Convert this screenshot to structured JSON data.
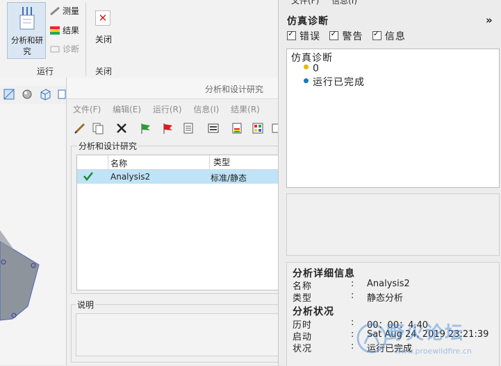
{
  "ribbon": {
    "analyze_label": "分析和研究",
    "measure_label": "测量",
    "results_label": "结果",
    "diagnose_label": "诊断",
    "close_label": "关闭",
    "group_run": "运行",
    "group_close": "关闭"
  },
  "dialog": {
    "title": "分析和设计研究",
    "menu": [
      "文件(F)",
      "编辑(E)",
      "运行(R)",
      "信息(I)",
      "结果(R)"
    ],
    "studies_caption": "分析和设计研究",
    "columns": {
      "name": "名称",
      "type": "类型"
    },
    "rows": [
      {
        "name": "Analysis2",
        "type": "标准/静态",
        "status_icon": "check-icon"
      }
    ],
    "description_caption": "说明"
  },
  "diagnostics": {
    "top_menu": [
      "文件(F)",
      "信息(I)"
    ],
    "title": "仿真诊断",
    "collapse": "»",
    "filters": {
      "errors": "错误",
      "warnings": "警告",
      "info": "信息"
    },
    "tree_root": "仿真诊断",
    "items": [
      {
        "text": "0",
        "color": "#e8b800"
      },
      {
        "text": "运行已完成",
        "color": "#1a77b8"
      }
    ]
  },
  "details": {
    "section1": "分析详细信息",
    "name_label": "名称",
    "name_value": "Analysis2",
    "type_label": "类型",
    "type_value": "静态分析",
    "section2": "分析状况",
    "elapsed_label": "历时",
    "elapsed_value": "00：00：4.40",
    "start_label": "启动",
    "start_value": "Sat Aug 24, 2019   23:21:39",
    "status_label": "状况",
    "status_value": "运行已完成",
    "colon": ":"
  },
  "watermark": {
    "main": "野火论坛",
    "url": "www.proewildfire.cn"
  },
  "colors": {
    "selection": "#bfe3f7",
    "accent": "#3e86d6"
  }
}
